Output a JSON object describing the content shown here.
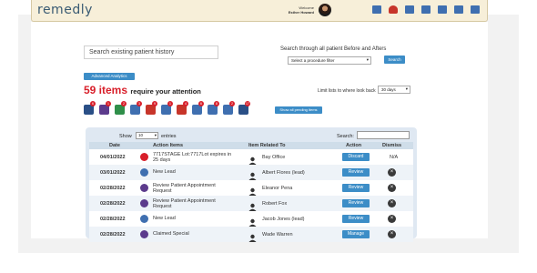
{
  "header": {
    "logo": "remedly",
    "welcome": "Welcome",
    "user_name": "Esther Howard",
    "icons": [
      "mail-icon",
      "bell-icon",
      "calendar-icon",
      "grid-icon",
      "clipboard-icon",
      "list-icon",
      "scale-icon",
      "chat-icon"
    ]
  },
  "search": {
    "history_placeholder": "Search existing patient history",
    "before_after_label": "Search through all patient Before and Afters",
    "procedure_filter": "Select a procedure filter",
    "search_button": "Search"
  },
  "advanced_analytics": "Advanced Analytics",
  "attention": {
    "count": "59 items",
    "subtitle": "require your attention",
    "limit_label": "Limit lists to where look back",
    "limit_value": "30 days",
    "show_all_button": "Show all pending items",
    "categories": [
      {
        "icon": "bag-icon",
        "badge": "6",
        "color": "#2a4f86"
      },
      {
        "icon": "document-icon",
        "badge": "1",
        "color": "#5c3b8c"
      },
      {
        "icon": "money-icon",
        "badge": "2",
        "color": "#2f8f4a"
      },
      {
        "icon": "tag-icon",
        "badge": "3",
        "color": "#3f6fb0"
      },
      {
        "icon": "phone-icon",
        "badge": "9",
        "color": "#c7352a"
      },
      {
        "icon": "people-icon",
        "badge": "1",
        "color": "#3f6fb0"
      },
      {
        "icon": "refresh-icon",
        "badge": "4",
        "color": "#c7352a"
      },
      {
        "icon": "gift-icon",
        "badge": "6",
        "color": "#3f6fb0"
      },
      {
        "icon": "calendar-icon",
        "badge": "8",
        "color": "#3f6fb0"
      },
      {
        "icon": "grid-icon",
        "badge": "2",
        "color": "#3f6fb0"
      },
      {
        "icon": "chat-icon",
        "badge": "17",
        "color": "#2a4f86"
      }
    ]
  },
  "table": {
    "show_label": "Show",
    "entries_value": "10",
    "entries_label": "entries",
    "search_label": "Search:",
    "columns": [
      "Date",
      "Action Items",
      "Item Related To",
      "Action",
      "Dismiss"
    ],
    "rows": [
      {
        "date": "04/01/2022",
        "item": "7717STAGE Lot:7717Lot expires in 25 days",
        "icon": "expiry-icon",
        "icon_color": "#d81f2a",
        "related": "Bay Office",
        "related_icon": "office-icon",
        "action": "Discard",
        "dismiss": "N/A"
      },
      {
        "date": "03/01/2022",
        "item": "New Lead",
        "icon": "lead-icon",
        "icon_color": "#3f6fb0",
        "related": "Albert Flores (lead)",
        "related_icon": "person-icon",
        "action": "Review",
        "dismiss": ""
      },
      {
        "date": "02/28/2022",
        "item": "Review Patient Appointment Request",
        "icon": "appointment-icon",
        "icon_color": "#5c3b8c",
        "related": "Eleanor Pena",
        "related_icon": "person-icon",
        "action": "Review",
        "dismiss": ""
      },
      {
        "date": "02/28/2022",
        "item": "Review Patient Appointment Request",
        "icon": "appointment-icon",
        "icon_color": "#5c3b8c",
        "related": "Robert Fox",
        "related_icon": "person-icon",
        "action": "Review",
        "dismiss": ""
      },
      {
        "date": "02/28/2022",
        "item": "New Lead",
        "icon": "lead-icon",
        "icon_color": "#3f6fb0",
        "related": "Jacob Jones (lead)",
        "related_icon": "person-icon",
        "action": "Review",
        "dismiss": ""
      },
      {
        "date": "02/28/2022",
        "item": "Claimed Special",
        "icon": "special-icon",
        "icon_color": "#5c3b8c",
        "related": "Wade Warren",
        "related_icon": "person-icon",
        "action": "Manage",
        "dismiss": ""
      }
    ]
  },
  "colors": {
    "accent": "#3c8dc7",
    "alert": "#d81f2a",
    "header_bg": "#f7efd9",
    "table_bg": "#dfe8f2"
  }
}
